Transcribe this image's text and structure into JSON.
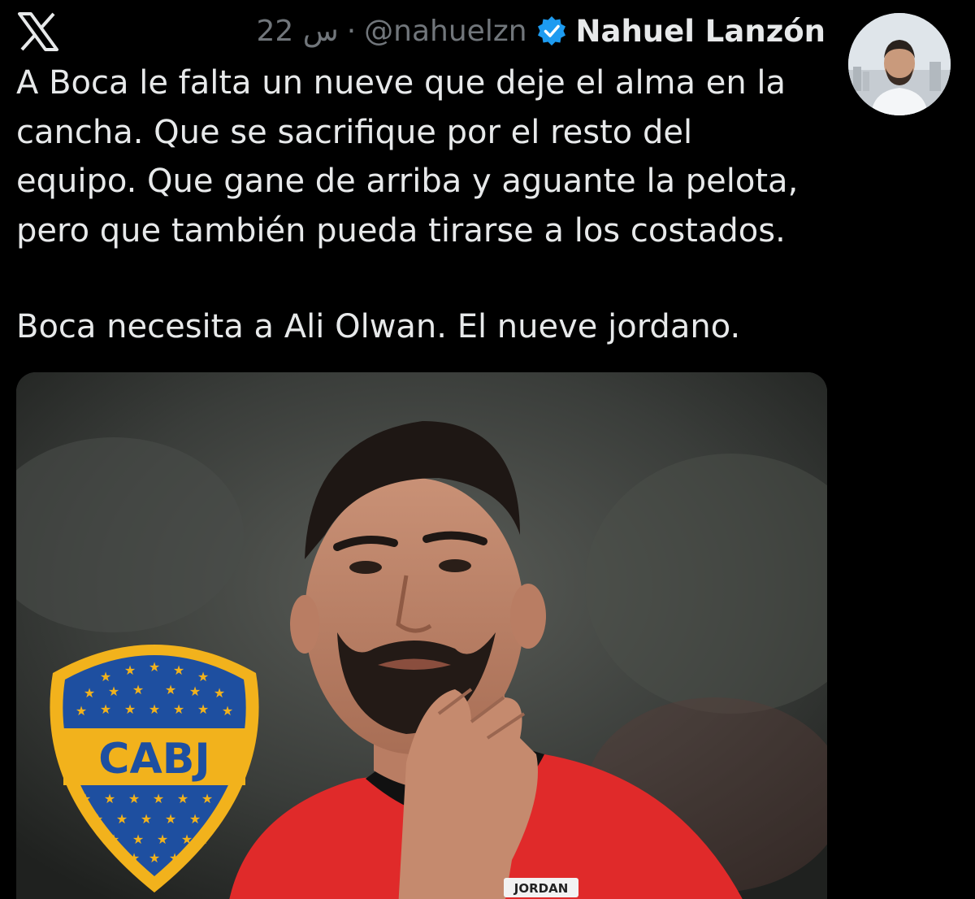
{
  "header": {
    "time": "22 س",
    "separator": "·",
    "handle": "@nahuelzn",
    "display_name": "Nahuel Lanzón",
    "logo_icon": "x-logo-icon",
    "verified_icon": "verified-badge-icon",
    "verified_color": "#1d9bf0"
  },
  "tweet": {
    "paragraph1_lines": [
      "A Boca le falta un nueve que deje el alma en la",
      "cancha. Que se sacrifique por el resto del",
      "equipo. Que gane de arriba y aguante la pelota,",
      "pero que también pueda tirarse a los costados."
    ],
    "paragraph2": "Boca necesita a Ali Olwan. El nueve jordano."
  },
  "media": {
    "crest_text": "CABJ",
    "jersey_label": "JORDAN",
    "crest_blue": "#1e4fa0",
    "crest_gold": "#f2b21c",
    "jersey_red": "#e02a2a"
  }
}
